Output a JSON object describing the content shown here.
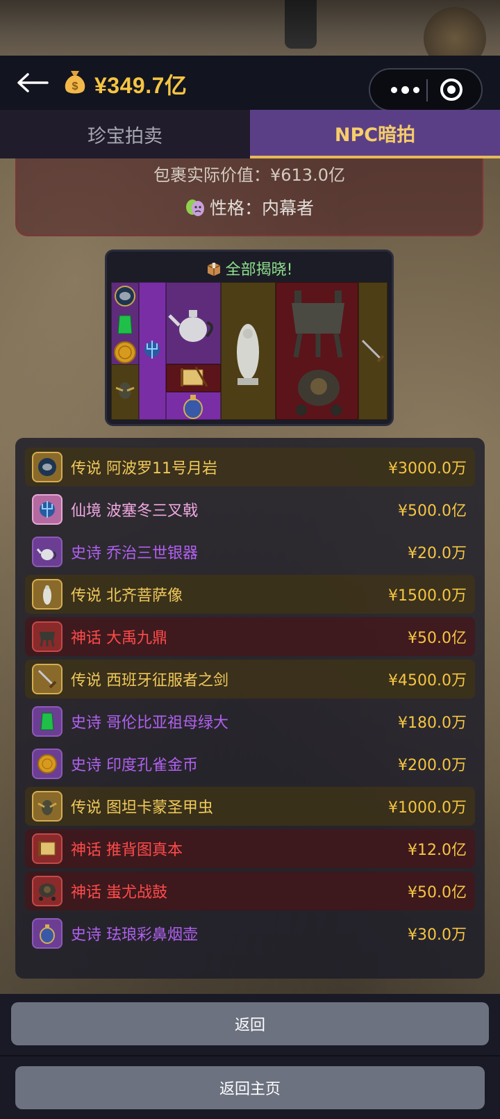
{
  "header": {
    "balance": "¥349.7亿"
  },
  "tabs": [
    {
      "label": "珍宝拍卖",
      "active": false
    },
    {
      "label": "NPC暗拍",
      "active": true
    }
  ],
  "info": {
    "package_value": "包裹实际价值：¥613.0亿",
    "personality": "性格：内幕者"
  },
  "grid": {
    "title": "全部揭晓!"
  },
  "items": [
    {
      "rarity": "传说",
      "name": "阿波罗11号月岩",
      "price": "¥3000.0万",
      "tier": "legend",
      "icon": "moon-rock-icon"
    },
    {
      "rarity": "仙境",
      "name": "波塞冬三叉戟",
      "price": "¥500.0亿",
      "tier": "fairy",
      "icon": "trident-icon"
    },
    {
      "rarity": "史诗",
      "name": "乔治三世银器",
      "price": "¥20.0万",
      "tier": "epic",
      "icon": "silver-teapot-icon"
    },
    {
      "rarity": "传说",
      "name": "北齐菩萨像",
      "price": "¥1500.0万",
      "tier": "legend",
      "icon": "bodhisattva-statue-icon"
    },
    {
      "rarity": "神话",
      "name": "大禹九鼎",
      "price": "¥50.0亿",
      "tier": "myth",
      "icon": "bronze-ding-icon"
    },
    {
      "rarity": "传说",
      "name": "西班牙征服者之剑",
      "price": "¥4500.0万",
      "tier": "legend",
      "icon": "sword-icon"
    },
    {
      "rarity": "史诗",
      "name": "哥伦比亚祖母绿大",
      "price": "¥180.0万",
      "tier": "epic",
      "icon": "emerald-icon"
    },
    {
      "rarity": "史诗",
      "name": "印度孔雀金币",
      "price": "¥200.0万",
      "tier": "epic",
      "icon": "gold-coin-icon"
    },
    {
      "rarity": "传说",
      "name": "图坦卡蒙圣甲虫",
      "price": "¥1000.0万",
      "tier": "legend",
      "icon": "scarab-icon"
    },
    {
      "rarity": "神话",
      "name": "推背图真本",
      "price": "¥12.0亿",
      "tier": "myth",
      "icon": "scroll-icon"
    },
    {
      "rarity": "神话",
      "name": "蚩尤战鼓",
      "price": "¥50.0亿",
      "tier": "myth",
      "icon": "war-drum-icon"
    },
    {
      "rarity": "史诗",
      "name": "珐琅彩鼻烟壶",
      "price": "¥30.0万",
      "tier": "epic",
      "icon": "snuff-bottle-icon"
    }
  ],
  "buttons": {
    "back": "返回",
    "home": "返回主页"
  },
  "colors": {
    "legend": "#f0c95a",
    "myth": "#ff4a4a",
    "epic": "#b160f0",
    "fairy": "#f0a8e0",
    "price": "#f5c542"
  }
}
